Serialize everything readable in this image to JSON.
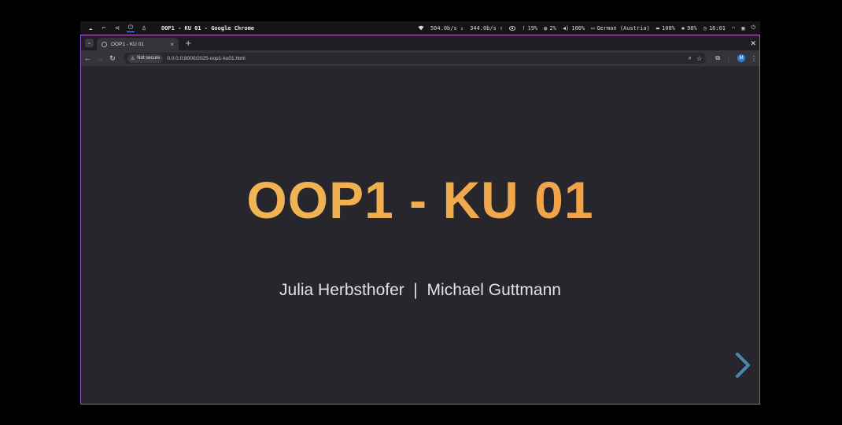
{
  "topbar": {
    "workspaces": [
      "☁",
      "⌐",
      "⋖",
      "⏻"
    ],
    "active_workspace_index": 3,
    "aux_icon": "♁",
    "window_title": "OOP1 - KU 01 - Google Chrome",
    "net_down": "504.0b/s ⇓",
    "net_up": "344.0b/s ⇑",
    "temp": "19%",
    "cpu": "2%",
    "volume": "100%",
    "keyboard": "German (Austria)",
    "battery": "100%",
    "brightness": "98%",
    "clock": "16:01"
  },
  "browser": {
    "tab_title": "OOP1 - KU 01",
    "security_label": "Not secure",
    "url": "0.0.0.0:8000/2025-oop1-ku01.html",
    "profile_initial": "M"
  },
  "slide": {
    "title": "OOP1 - KU 01",
    "authors": "Julia Herbsthofer  |  Michael Guttmann"
  },
  "colors": {
    "title_gradient_start": "#f0bd58",
    "title_gradient_end": "#ef9a45",
    "arrow": "#4a87b0",
    "window_border": "#8a5cc7"
  }
}
